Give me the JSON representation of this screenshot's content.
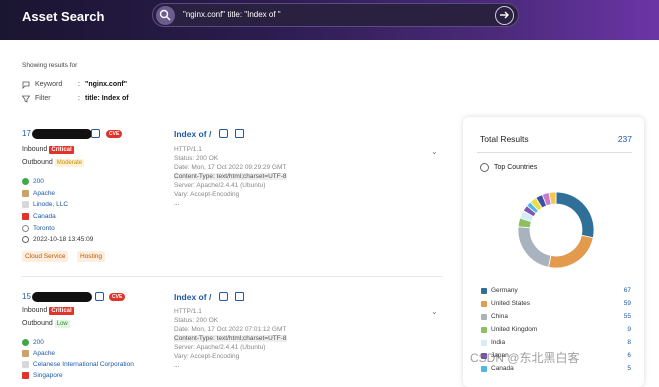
{
  "header": {
    "title": "Asset Search",
    "search_query": "\"nginx.conf\" title: \"Index of \""
  },
  "filters": {
    "showing_label": "Showing results for",
    "keyword_label": "Keyword",
    "keyword_value": "\"nginx.conf\"",
    "filter_label": "Filter",
    "filter_value": "title: Index of"
  },
  "results": [
    {
      "ip_prefix": "17",
      "cve": "CVE",
      "inbound_label": "Inbound",
      "inbound_badge": "Critical",
      "outbound_label": "Outbound",
      "outbound_badge": "Moderate",
      "status": "200",
      "server": "Apache",
      "org": "Linode, LLC",
      "country": "Canada",
      "city": "Toronto",
      "time": "2022-10-18 13:45:09",
      "tags": [
        "Cloud Service",
        "Hosting"
      ],
      "detail_title": "Index of /",
      "detail_lines": [
        "HTTP/1.1",
        "Status: 200 OK",
        "Date: Mon, 17 Oct 2022 09:29:29 GMT",
        "Content-Type: text/html;charset=UTF-8",
        "Server: Apache/2.4.41 (Ubuntu)",
        "Vary: Accept-Encoding",
        "..."
      ]
    },
    {
      "ip_prefix": "15",
      "cve": "CVE",
      "inbound_label": "Inbound",
      "inbound_badge": "Critical",
      "outbound_label": "Outbound",
      "outbound_badge": "Low",
      "status": "200",
      "server": "Apache",
      "org": "Celanese International Corporation",
      "country": "Singapore",
      "detail_title": "Index of /",
      "detail_lines": [
        "HTTP/1.1",
        "Status: 200 OK",
        "Date: Mon, 17 Oct 2022 07:01:12 GMT",
        "Content-Type: text/html;charset=UTF-8",
        "Server: Apache/2.4.41 (Ubuntu)",
        "Vary: Accept-Encoding",
        "..."
      ]
    }
  ],
  "panel": {
    "total_label": "Total Results",
    "total_value": "237",
    "top_countries_label": "Top Countries",
    "countries": [
      {
        "name": "Germany",
        "count": 67,
        "color": "#2f6f98"
      },
      {
        "name": "United States",
        "count": 59,
        "color": "#e39a4d"
      },
      {
        "name": "China",
        "count": 55,
        "color": "#a9b3bd"
      },
      {
        "name": "United Kingdom",
        "count": 9,
        "color": "#8cc063"
      },
      {
        "name": "India",
        "count": 8,
        "color": "#d7ecf5"
      },
      {
        "name": "Japan",
        "count": 6,
        "color": "#7e58b6"
      },
      {
        "name": "Canada",
        "count": 5,
        "color": "#4fb6e6"
      }
    ],
    "donut_other_colors": [
      "#e8e04a",
      "#3c4fa0",
      "#c97ad0",
      "#f2c94c"
    ]
  },
  "watermark": "CSDN @东北黑白客"
}
